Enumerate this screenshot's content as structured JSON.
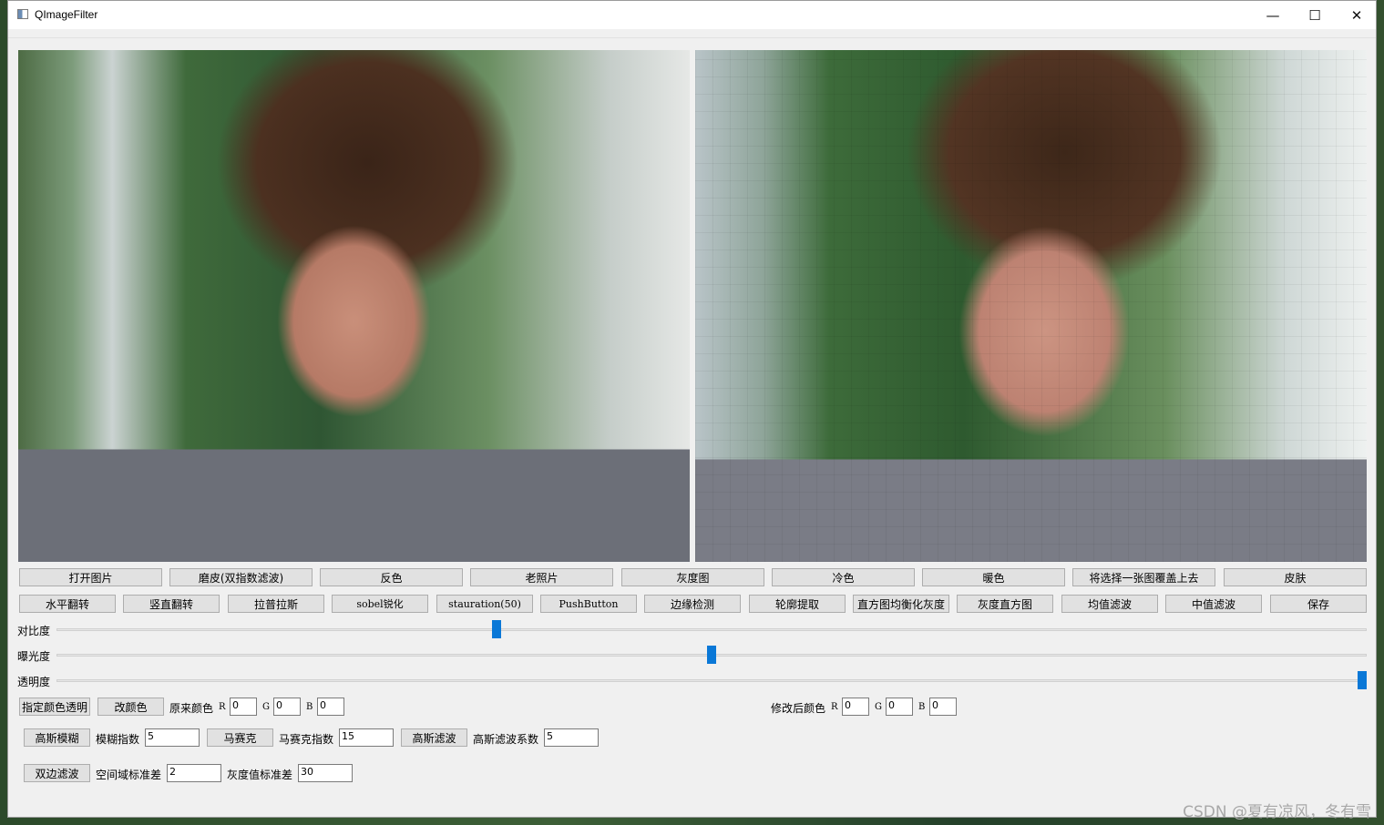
{
  "window": {
    "title": "QImageFilter"
  },
  "row1": [
    "打开图片",
    "磨皮(双指数滤波)",
    "反色",
    "老照片",
    "灰度图",
    "冷色",
    "暖色",
    "将选择一张图覆盖上去",
    "皮肤"
  ],
  "row2": [
    "水平翻转",
    "竖直翻转",
    "拉普拉斯",
    "sobel锐化",
    "stauration(50)",
    "PushButton",
    "边缘检测",
    "轮廓提取",
    "直方图均衡化灰度",
    "灰度直方图",
    "均值滤波",
    "中值滤波",
    "保存"
  ],
  "sliders": {
    "contrast": {
      "label": "对比度",
      "value_fraction": 0.335
    },
    "exposure": {
      "label": "曝光度",
      "value_fraction": 0.5
    },
    "opacity": {
      "label": "透明度",
      "value_fraction": 1.0
    }
  },
  "color_row": {
    "transparent_btn": "指定颜色透明",
    "change_btn": "改颜色",
    "orig_label": "原来颜色",
    "new_label": "修改后颜色",
    "r": "R",
    "g": "G",
    "b": "B",
    "orig": {
      "r": "0",
      "g": "0",
      "b": "0"
    },
    "new": {
      "r": "0",
      "g": "0",
      "b": "0"
    }
  },
  "blur_row": {
    "gauss_blur_btn": "高斯模糊",
    "blur_index_label": "模糊指数",
    "blur_index": "5",
    "mosaic_btn": "马赛克",
    "mosaic_index_label": "马赛克指数",
    "mosaic_index": "15",
    "gauss_filter_btn": "高斯滤波",
    "gauss_coef_label": "高斯滤波系数",
    "gauss_coef": "5"
  },
  "bilateral_row": {
    "btn": "双边滤波",
    "space_label": "空间域标准差",
    "space_value": "2",
    "gray_label": "灰度值标准差",
    "gray_value": "30"
  },
  "watermark": "CSDN @夏有凉风，冬有雪",
  "colors": {
    "slider_handle": "#0a78d7",
    "window_bg": "#f0f0f0",
    "button_bg": "#e1e1e1"
  }
}
